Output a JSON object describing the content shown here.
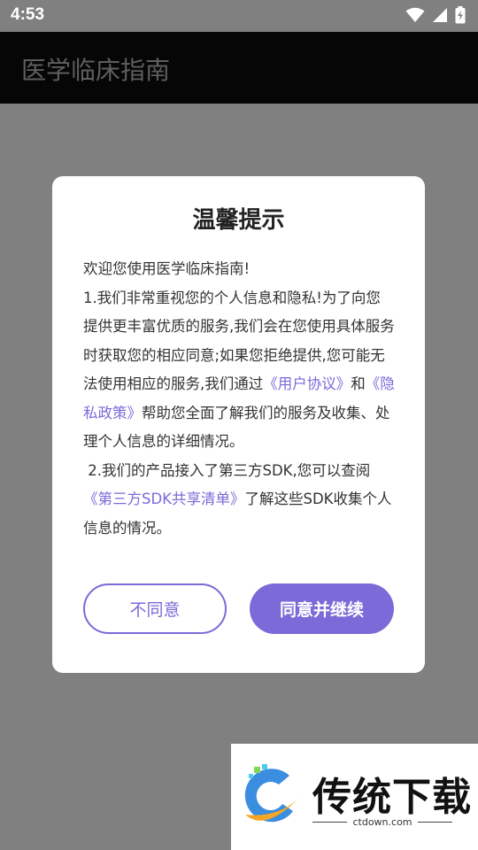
{
  "status_bar": {
    "time": "4:53"
  },
  "app_bar": {
    "title": "医学临床指南"
  },
  "dialog": {
    "title": "温馨提示",
    "greeting": "欢迎您使用医学临床指南!",
    "p1_text_a": "1.我们非常重视您的个人信息和隐私!为了向您提供更丰富优质的服务,我们会在您使用具体服务时获取您的相应同意;如果您拒绝提供,您可能无法使用相应的服务,我们通过",
    "p1_link_user": "《用户协议》",
    "p1_and": "和",
    "p1_link_privacy": "《隐私政策》",
    "p1_text_b": "帮助您全面了解我们的服务及收集、处理个人信息的详细情况。",
    "p2_text_a": " 2.我们的产品接入了第三方SDK,您可以查阅",
    "p2_link_sdk": "《第三方SDK共享清单》",
    "p2_text_b": "了解这些SDK收集个人信息的情况。",
    "disagree_label": "不同意",
    "agree_label": "同意并继续"
  },
  "watermark": {
    "name": "传统下载",
    "url": "ctdown.com"
  },
  "colors": {
    "accent": "#7b6ad8",
    "overlay": "#808080",
    "app_bar": "#060606"
  }
}
